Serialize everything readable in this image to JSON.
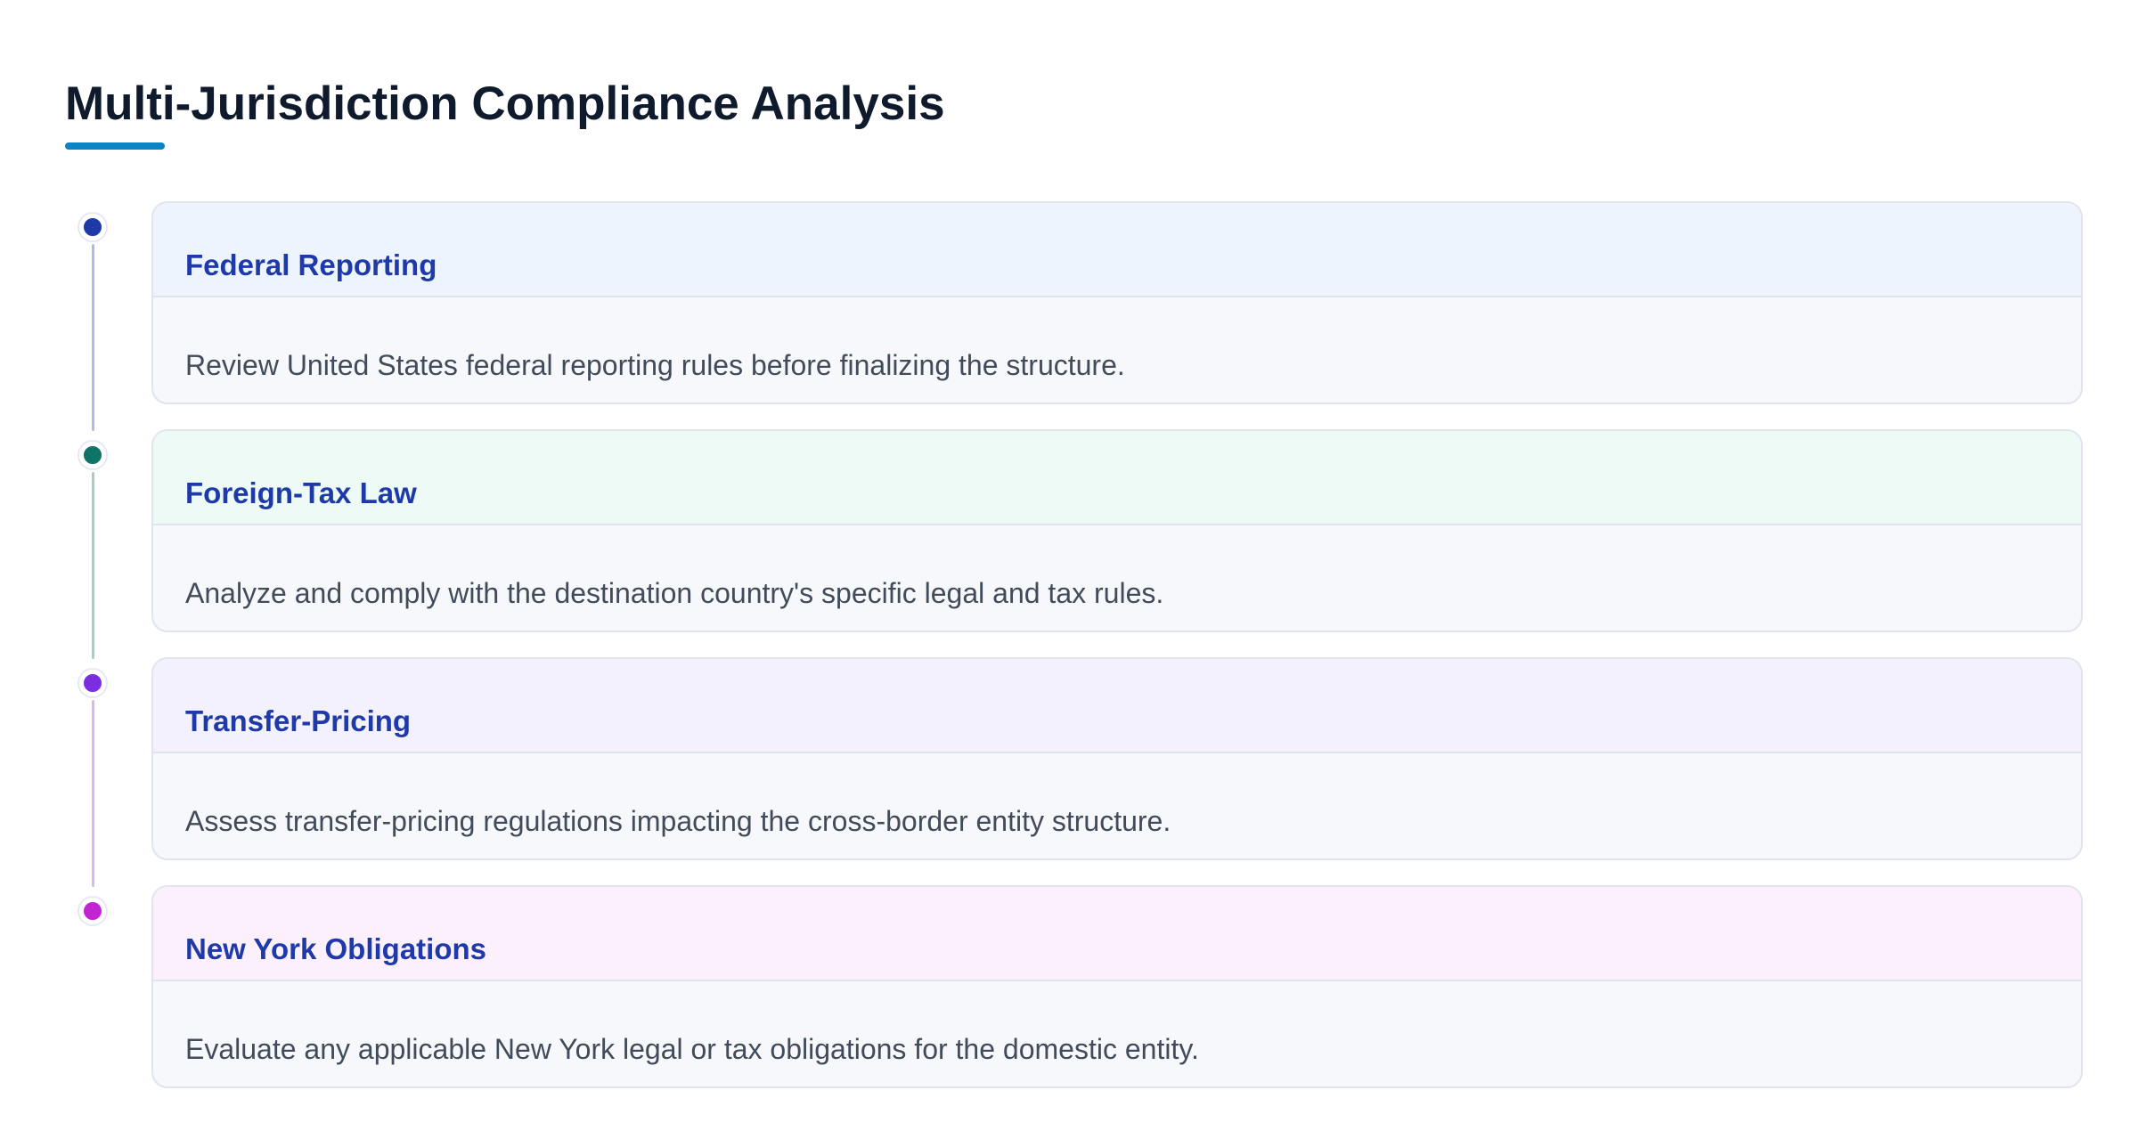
{
  "title": "Multi-Jurisdiction Compliance Analysis",
  "accent_color": "#0b84c6",
  "steps": [
    {
      "title": "Federal Reporting",
      "description": "Review United States federal reporting rules before finalizing the structure.",
      "dot_color": "#1e3aa8",
      "line_color": "#b4b9ec",
      "header_bg": "#eef4fe"
    },
    {
      "title": "Foreign-Tax Law",
      "description": "Analyze and comply with the destination country's specific legal and tax rules.",
      "dot_color": "#0f7468",
      "line_color": "#a9cec9",
      "header_bg": "#edfaf6"
    },
    {
      "title": "Transfer-Pricing",
      "description": "Assess transfer-pricing regulations impacting the cross-border entity structure.",
      "dot_color": "#7a2ee0",
      "line_color": "#d4b9f5",
      "header_bg": "#f3f1fd"
    },
    {
      "title": "New York Obligations",
      "description": "Evaluate any applicable New York legal or tax obligations for the domestic entity.",
      "dot_color": "#c224d4",
      "line_color": "",
      "header_bg": "#fdf0fd"
    }
  ]
}
